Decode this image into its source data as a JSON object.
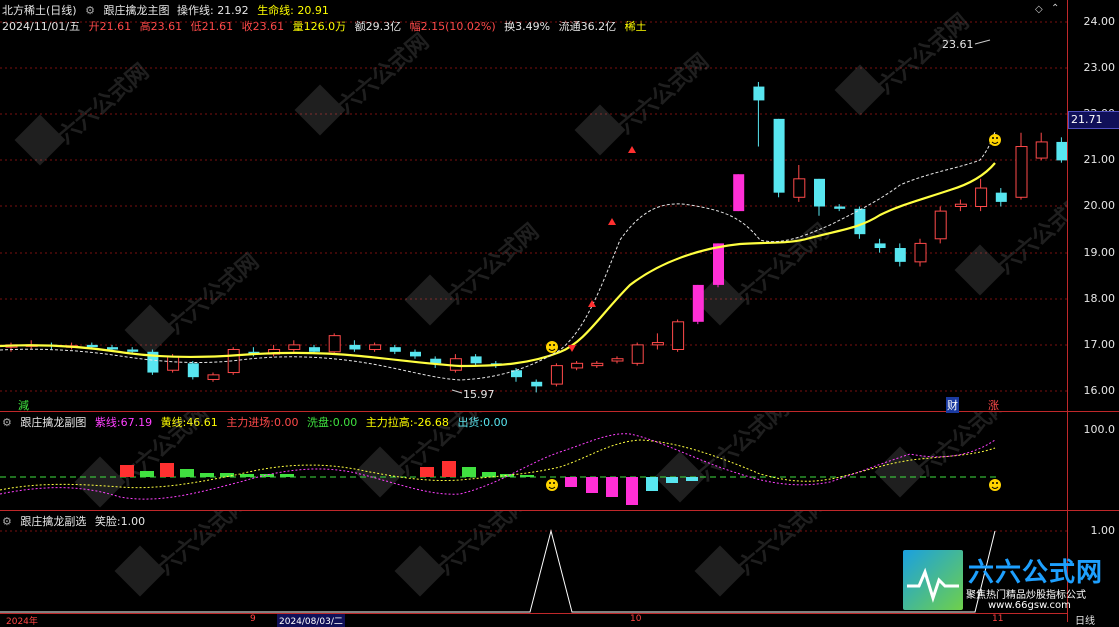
{
  "header": {
    "title": "北方稀土(日线)",
    "main_indicator": "跟庄擒龙主图",
    "op_line_label": "操作线:",
    "op_line_value": "21.92",
    "life_line_label": "生命线:",
    "life_line_value": "20.91"
  },
  "quote": {
    "date": "2024/11/01/五",
    "open_label": "开",
    "open": "21.61",
    "high_label": "高",
    "high": "23.61",
    "low_label": "低",
    "low": "21.61",
    "close_label": "收",
    "close": "23.61",
    "volume_label": "量",
    "volume": "126.0万",
    "amount_label": "额",
    "amount": "29.3亿",
    "change_label": "幅",
    "change": "2.15(10.02%)",
    "turnover_label": "换",
    "turnover": "3.49%",
    "float_label": "流通",
    "float": "36.2亿",
    "tag": "稀土"
  },
  "price_axis": [
    "24.00",
    "23.00",
    "22.00",
    "21.00",
    "20.00",
    "19.00",
    "18.00",
    "17.00",
    "16.00"
  ],
  "current_price_tag": "21.71",
  "annotations": {
    "high_marker": "23.61",
    "low_marker": "15.97",
    "reduce_label": "減",
    "finance_label": "财",
    "rise_label": "涨"
  },
  "sub1": {
    "title": "跟庄擒龙副图",
    "purple_label": "紫线:",
    "purple_value": "67.19",
    "yellow_label": "黄线:",
    "yellow_value": "46.61",
    "main_in_label": "主力进场:",
    "main_in_value": "0.00",
    "wash_label": "洗盘:",
    "wash_value": "0.00",
    "pull_label": "主力拉高:",
    "pull_value": "-26.68",
    "out_label": "出货:",
    "out_value": "0.00",
    "axis_top": "100.0"
  },
  "sub2": {
    "title": "跟庄擒龙副选",
    "smile_label": "笑脸:",
    "smile_value": "1.00",
    "axis_top": "1.00"
  },
  "bottom": {
    "year_label": "2024年",
    "tick_9": "9",
    "date_label": "2024/08/03/二",
    "tick_10": "10",
    "tick_11": "11",
    "period": "日线"
  },
  "watermark": {
    "brand": "六六公式网",
    "slogan": "聚焦热门精品炒股指标公式",
    "url": "www.66gsw.com"
  },
  "colors": {
    "up": "#ff4a4a",
    "down": "#58e6f0",
    "ma_yellow": "#ffff40",
    "op_line": "#ffffff",
    "limit_up": "#ff2fd6",
    "border": "#c0282a"
  }
}
